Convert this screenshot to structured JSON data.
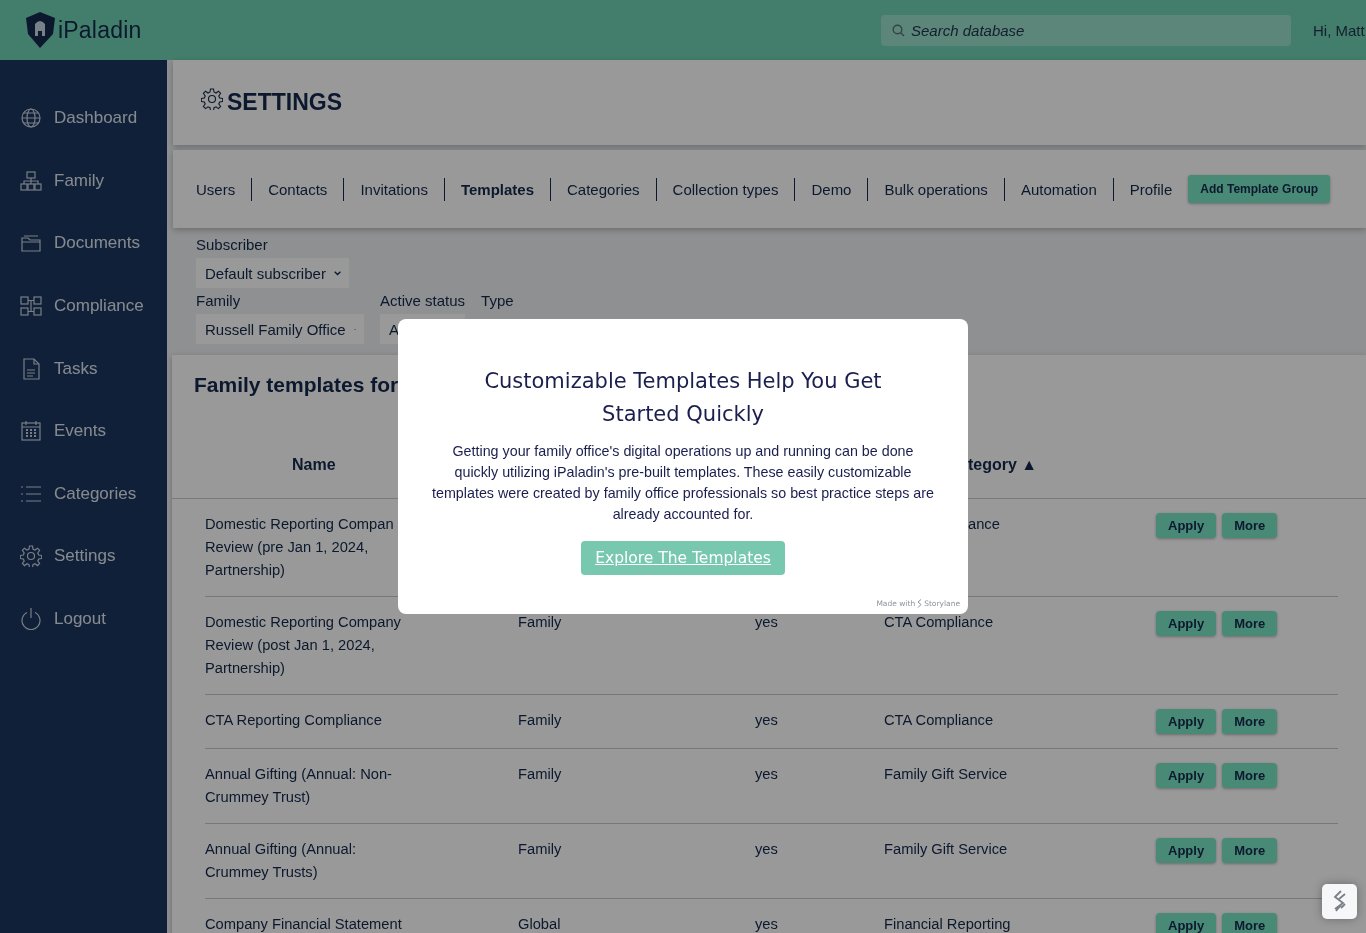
{
  "header": {
    "logo_text": "iPaladin",
    "search": {
      "placeholder": "Search database"
    },
    "greeting": "Hi, Matt"
  },
  "sidebar": {
    "items": [
      {
        "label": "Dashboard"
      },
      {
        "label": "Family"
      },
      {
        "label": "Documents"
      },
      {
        "label": "Compliance"
      },
      {
        "label": "Tasks"
      },
      {
        "label": "Events"
      },
      {
        "label": "Categories"
      },
      {
        "label": "Settings"
      },
      {
        "label": "Logout"
      }
    ]
  },
  "page": {
    "title": "SETTINGS"
  },
  "tabs": [
    {
      "label": "Users",
      "selected": false
    },
    {
      "label": "Contacts",
      "selected": false
    },
    {
      "label": "Invitations",
      "selected": false
    },
    {
      "label": "Templates",
      "selected": true
    },
    {
      "label": "Categories",
      "selected": false
    },
    {
      "label": "Collection types",
      "selected": false
    },
    {
      "label": "Demo",
      "selected": false
    },
    {
      "label": "Bulk operations",
      "selected": false
    },
    {
      "label": "Automation",
      "selected": false
    },
    {
      "label": "Profile",
      "selected": false
    }
  ],
  "add_button": "Add Template Group",
  "filters": {
    "subscriber": {
      "label": "Subscriber",
      "value": "Default subscriber"
    },
    "family": {
      "label": "Family",
      "value": "Russell Family Office"
    },
    "active_status": {
      "label": "Active status",
      "value": "A"
    },
    "type": {
      "label": "Type"
    }
  },
  "table": {
    "title": "Family templates for",
    "header": {
      "name": "Name",
      "category": "tegory ▲",
      "category_clipped": true
    },
    "rows": [
      {
        "name": "Domestic Reporting Compan\nReview (pre Jan 1, 2024,\nPartnership)",
        "category": "ance",
        "category_clipped": true,
        "actions": [
          "Apply",
          "More"
        ]
      },
      {
        "name": "Domestic Reporting Company\nReview (post Jan 1, 2024,\nPartnership)",
        "type": "Family",
        "active": "yes",
        "category": "CTA Compliance",
        "category_clipped": false,
        "actions": [
          "Apply",
          "More"
        ]
      },
      {
        "name": "CTA Reporting Compliance",
        "type": "Family",
        "active": "yes",
        "category": "CTA Compliance",
        "category_clipped": false,
        "actions": [
          "Apply",
          "More"
        ]
      },
      {
        "name": "Annual Gifting (Annual: Non-\nCrummey Trust)",
        "type": "Family",
        "active": "yes",
        "category": "Family Gift Service",
        "category_clipped": false,
        "actions": [
          "Apply",
          "More"
        ]
      },
      {
        "name": "Annual Gifting (Annual:\nCrummey Trusts)",
        "type": "Family",
        "active": "yes",
        "category": "Family Gift Service",
        "category_clipped": false,
        "actions": [
          "Apply",
          "More"
        ]
      },
      {
        "name": "Company Financial Statement",
        "type": "Global",
        "active": "yes",
        "category": "Financial Reporting",
        "category_clipped": false,
        "actions": [
          "Apply",
          "More"
        ]
      }
    ]
  },
  "modal": {
    "title": "Customizable Templates Help You Get Started Quickly",
    "body": "Getting your family office's digital operations up and running can be done quickly utilizing iPaladin's pre-built templates. These easily customizable templates were created by family office professionals so best practice steps are already accounted for.",
    "button": "Explore The Templates",
    "credit": "Made with",
    "credit_brand": "Storylane"
  }
}
